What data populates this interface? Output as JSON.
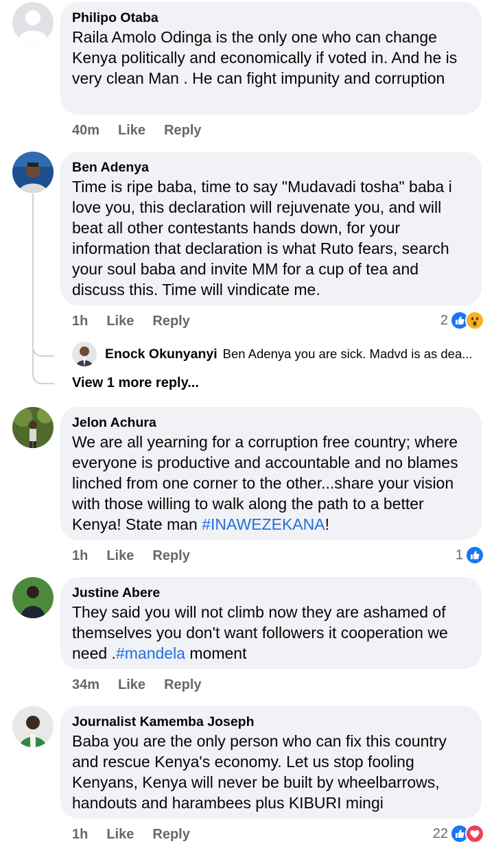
{
  "comments": [
    {
      "author": "Philipo Otaba",
      "text": "Raila Amolo Odinga is the only one who can change Kenya politically and economically if voted in. And he is very clean Man . He can fight impunity and corruption",
      "time": "40m",
      "like": "Like",
      "reply": "Reply"
    },
    {
      "author": "Ben Adenya",
      "text": "Time is ripe baba, time to say \"Mudavadi tosha\" baba i love you, this declaration will rejuvenate you, and will beat all other contestants hands down, for your information that declaration is what Ruto fears, search your soul baba and invite MM for a cup of tea and discuss this. Time will vindicate me.",
      "time": "1h",
      "like": "Like",
      "reply": "Reply",
      "reaction_count": "2",
      "reactions": [
        "like-icon",
        "wow-icon"
      ],
      "nested_reply": {
        "author": "Enock Okunyanyi",
        "text": "Ben Adenya you are sick. Madvd is as dea..."
      },
      "more_replies": "View 1 more reply..."
    },
    {
      "author": "Jelon Achura",
      "text_before": "We are all yearning for a corruption free country; where everyone is productive and accountable and no blames linched from one corner to the other...share your vision with those willing to walk along the path to a better Kenya! State man ",
      "hashtag": "#INAWEZEKANA",
      "text_after": "!",
      "time": "1h",
      "like": "Like",
      "reply": "Reply",
      "reaction_count": "1",
      "reactions": [
        "like-icon"
      ]
    },
    {
      "author": "Justine Abere",
      "text_before": "They said you will not climb now they are ashamed of themselves you don't want followers it cooperation we need .",
      "hashtag": "#mandela",
      "text_after": " moment",
      "time": "34m",
      "like": "Like",
      "reply": "Reply"
    },
    {
      "author": "Journalist Kamemba Joseph",
      "text": "Baba you are the only person who can fix this country and rescue Kenya's economy. Let us stop fooling Kenyans, Kenya will never be built by wheelbarrows, handouts and harambees plus KIBURI mingi",
      "time": "1h",
      "like": "Like",
      "reply": "Reply",
      "reaction_count": "22",
      "reactions": [
        "like-icon",
        "love-icon"
      ]
    }
  ],
  "colors": {
    "bubble": "#f0f2f5",
    "meta": "#65676b",
    "hashtag": "#216fdb",
    "like": "#1877f2",
    "love": "#f33e58",
    "wow": "#f7b125"
  }
}
